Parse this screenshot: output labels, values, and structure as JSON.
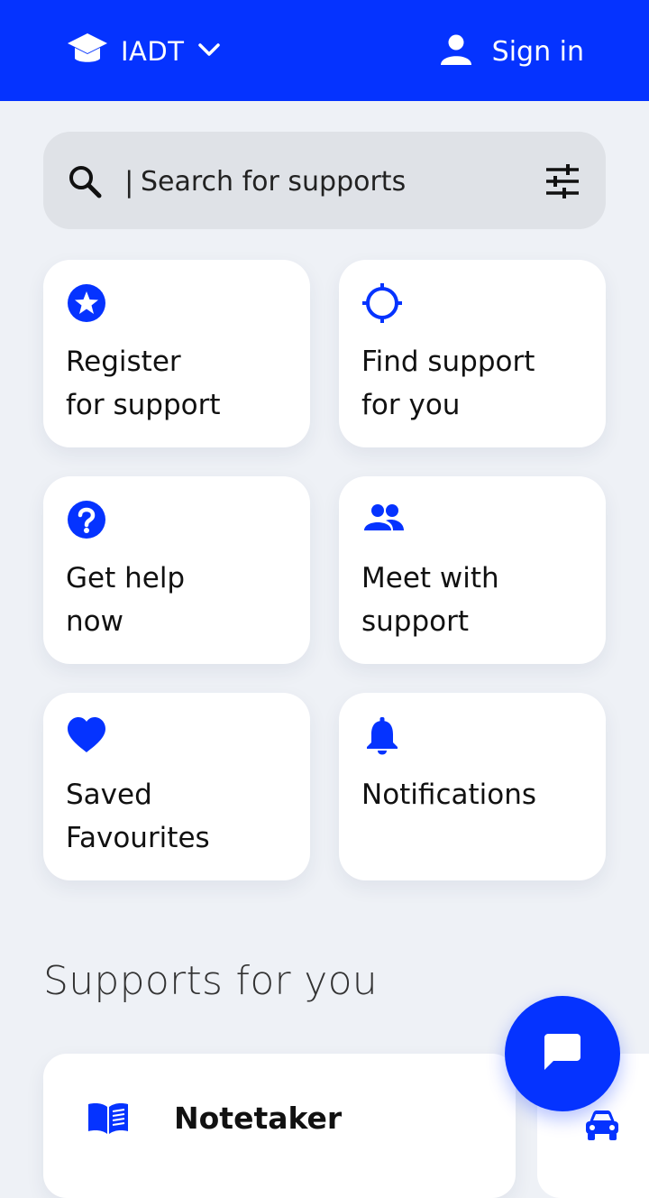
{
  "header": {
    "institution": "IADT",
    "institution_icon": "graduation-cap-icon",
    "dropdown_icon": "chevron-down-icon",
    "signin_label": "Sign in",
    "signin_icon": "person-icon",
    "accent": "#0533ff"
  },
  "search": {
    "placeholder": "Search for supports",
    "value": ""
  },
  "tiles": [
    {
      "label": "Register\nfor support",
      "icon": "star-badge-icon"
    },
    {
      "label": "Find support\nfor you",
      "icon": "crosshair-icon"
    },
    {
      "label": "Get help\nnow",
      "icon": "help-circle-icon"
    },
    {
      "label": "Meet with\nsupport",
      "icon": "people-icon"
    },
    {
      "label": "Saved\nFavourites",
      "icon": "heart-icon"
    },
    {
      "label": "Notifications",
      "icon": "bell-icon"
    }
  ],
  "supports_section": {
    "title": "Supports for you",
    "items": [
      {
        "title": "Notetaker",
        "icon": "book-icon"
      },
      {
        "title": "",
        "icon": "car-icon"
      }
    ]
  },
  "chat_fab": {
    "icon": "chat-bubble-icon"
  }
}
